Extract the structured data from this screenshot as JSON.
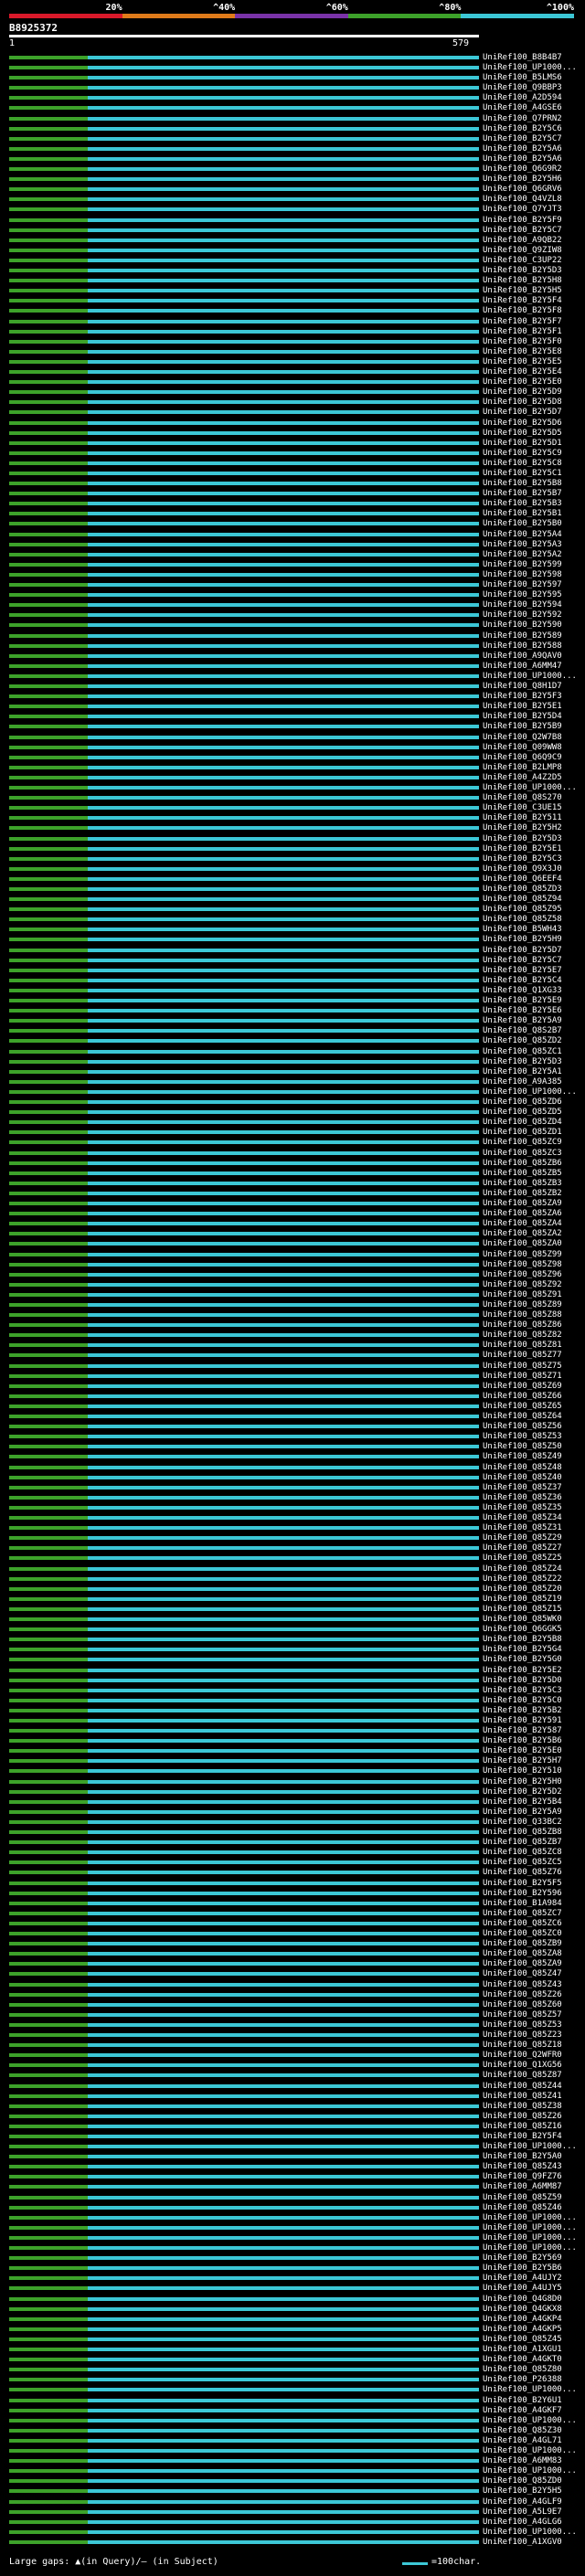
{
  "scale": {
    "labels": [
      "20%",
      "^40%",
      "^60%",
      "^80%",
      "^100%"
    ],
    "colors": [
      "#d9192a",
      "#e07b1a",
      "#7a33a8",
      "#3da22a",
      "#3cc7d6"
    ]
  },
  "query": {
    "id": "B8925372",
    "start": "1",
    "end": "579"
  },
  "colors": {
    "high": "#3cc7d6",
    "medium": "#3da22a",
    "background": "#000000",
    "text": "#ffffff"
  },
  "hits": [
    "UniRef100_B8B4B7",
    "UniRef100_UP1000...",
    "UniRef100_B5LMS6",
    "UniRef100_Q9BBP3",
    "UniRef100_A2D594",
    "UniRef100_A4GSE6",
    "UniRef100_Q7PRN2",
    "UniRef100_B2Y5C6",
    "UniRef100_B2Y5C7",
    "UniRef100_B2Y5A6",
    "UniRef100_B2Y5A6",
    "UniRef100_Q6G9R2",
    "UniRef100_B2Y5H6",
    "UniRef100_Q6GRV6",
    "UniRef100_Q4VZL8",
    "UniRef100_Q7YJT3",
    "UniRef100_B2Y5F9",
    "UniRef100_B2Y5C7",
    "UniRef100_A9QB22",
    "UniRef100_Q9ZIW8",
    "UniRef100_C3UP22",
    "UniRef100_B2Y5D3",
    "UniRef100_B2Y5H8",
    "UniRef100_B2Y5H5",
    "UniRef100_B2Y5F4",
    "UniRef100_B2Y5F8",
    "UniRef100_B2Y5F7",
    "UniRef100_B2Y5F1",
    "UniRef100_B2Y5F0",
    "UniRef100_B2Y5E8",
    "UniRef100_B2Y5E5",
    "UniRef100_B2Y5E4",
    "UniRef100_B2Y5E0",
    "UniRef100_B2Y5D9",
    "UniRef100_B2Y5D8",
    "UniRef100_B2Y5D7",
    "UniRef100_B2Y5D6",
    "UniRef100_B2Y5D5",
    "UniRef100_B2Y5D1",
    "UniRef100_B2Y5C9",
    "UniRef100_B2Y5C8",
    "UniRef100_B2Y5C1",
    "UniRef100_B2Y5B8",
    "UniRef100_B2Y5B7",
    "UniRef100_B2Y5B3",
    "UniRef100_B2Y5B1",
    "UniRef100_B2Y5B0",
    "UniRef100_B2Y5A4",
    "UniRef100_B2Y5A3",
    "UniRef100_B2Y5A2",
    "UniRef100_B2Y599",
    "UniRef100_B2Y598",
    "UniRef100_B2Y597",
    "UniRef100_B2Y595",
    "UniRef100_B2Y594",
    "UniRef100_B2Y592",
    "UniRef100_B2Y590",
    "UniRef100_B2Y589",
    "UniRef100_B2Y588",
    "UniRef100_A9QAV0",
    "UniRef100_A6MM47",
    "UniRef100_UP1000...",
    "UniRef100_Q8H1D7",
    "UniRef100_B2Y5F3",
    "UniRef100_B2Y5E1",
    "UniRef100_B2Y5D4",
    "UniRef100_B2Y5B9",
    "UniRef100_Q2W7B8",
    "UniRef100_Q09WW8",
    "UniRef100_Q6Q9C9",
    "UniRef100_B2LMP8",
    "UniRef100_A4Z2D5",
    "UniRef100_UP1000...",
    "UniRef100_Q8S270",
    "UniRef100_C3UE15",
    "UniRef100_B2Y511",
    "UniRef100_B2Y5H2",
    "UniRef100_B2Y5D3",
    "UniRef100_B2Y5E1",
    "UniRef100_B2Y5C3",
    "UniRef100_Q9X3J0",
    "UniRef100_Q6EEF4",
    "UniRef100_Q85ZD3",
    "UniRef100_Q85Z94",
    "UniRef100_Q85Z95",
    "UniRef100_Q85Z58",
    "UniRef100_B5WH43",
    "UniRef100_B2Y5H9",
    "UniRef100_B2Y5D7",
    "UniRef100_B2Y5C7",
    "UniRef100_B2Y5E7",
    "UniRef100_B2Y5C4",
    "UniRef100_Q1XG33",
    "UniRef100_B2Y5E9",
    "UniRef100_B2Y5E6",
    "UniRef100_B2Y5A9",
    "UniRef100_Q8S2B7",
    "UniRef100_Q85ZD2",
    "UniRef100_Q85ZC1",
    "UniRef100_B2Y5D3",
    "UniRef100_B2Y5A1",
    "UniRef100_A9A385",
    "UniRef100_UP1000...",
    "UniRef100_Q85ZD6",
    "UniRef100_Q85ZD5",
    "UniRef100_Q85ZD4",
    "UniRef100_Q85ZD1",
    "UniRef100_Q85ZC9",
    "UniRef100_Q85ZC3",
    "UniRef100_Q85ZB6",
    "UniRef100_Q85ZB5",
    "UniRef100_Q85ZB3",
    "UniRef100_Q85ZB2",
    "UniRef100_Q85ZA9",
    "UniRef100_Q85ZA6",
    "UniRef100_Q85ZA4",
    "UniRef100_Q85ZA2",
    "UniRef100_Q85ZA0",
    "UniRef100_Q85Z99",
    "UniRef100_Q85Z98",
    "UniRef100_Q85Z96",
    "UniRef100_Q85Z92",
    "UniRef100_Q85Z91",
    "UniRef100_Q85Z89",
    "UniRef100_Q85Z88",
    "UniRef100_Q85Z86",
    "UniRef100_Q85Z82",
    "UniRef100_Q85Z81",
    "UniRef100_Q85Z77",
    "UniRef100_Q85Z75",
    "UniRef100_Q85Z71",
    "UniRef100_Q85Z69",
    "UniRef100_Q85Z66",
    "UniRef100_Q85Z65",
    "UniRef100_Q85Z64",
    "UniRef100_Q85Z56",
    "UniRef100_Q85Z53",
    "UniRef100_Q85Z50",
    "UniRef100_Q85Z49",
    "UniRef100_Q85Z48",
    "UniRef100_Q85Z40",
    "UniRef100_Q85Z37",
    "UniRef100_Q85Z36",
    "UniRef100_Q85Z35",
    "UniRef100_Q85Z34",
    "UniRef100_Q85Z31",
    "UniRef100_Q85Z29",
    "UniRef100_Q85Z27",
    "UniRef100_Q85Z25",
    "UniRef100_Q85Z24",
    "UniRef100_Q85Z22",
    "UniRef100_Q85Z20",
    "UniRef100_Q85Z19",
    "UniRef100_Q85Z15",
    "UniRef100_Q85WK0",
    "UniRef100_Q6GGK5",
    "UniRef100_B2Y5B8",
    "UniRef100_B2Y5G4",
    "UniRef100_B2Y5G0",
    "UniRef100_B2Y5E2",
    "UniRef100_B2Y5D0",
    "UniRef100_B2Y5C3",
    "UniRef100_B2Y5C0",
    "UniRef100_B2Y5B2",
    "UniRef100_B2Y591",
    "UniRef100_B2Y587",
    "UniRef100_B2Y5B6",
    "UniRef100_B2Y5E0",
    "UniRef100_B2Y5H7",
    "UniRef100_B2Y510",
    "UniRef100_B2Y5H0",
    "UniRef100_B2Y5D2",
    "UniRef100_B2Y5B4",
    "UniRef100_B2Y5A9",
    "UniRef100_Q33BC2",
    "UniRef100_Q85ZB8",
    "UniRef100_Q85ZB7",
    "UniRef100_Q85ZC8",
    "UniRef100_Q85ZC5",
    "UniRef100_Q85Z76",
    "UniRef100_B2Y5F5",
    "UniRef100_B2Y596",
    "UniRef100_B1A984",
    "UniRef100_Q85ZC7",
    "UniRef100_Q85ZC6",
    "UniRef100_Q85ZC0",
    "UniRef100_Q85ZB9",
    "UniRef100_Q85ZA8",
    "UniRef100_Q85ZA9",
    "UniRef100_Q85Z47",
    "UniRef100_Q85Z43",
    "UniRef100_Q85Z26",
    "UniRef100_Q85Z60",
    "UniRef100_Q85Z57",
    "UniRef100_Q85Z53",
    "UniRef100_Q85Z23",
    "UniRef100_Q85Z18",
    "UniRef100_Q2WFR0",
    "UniRef100_Q1XG56",
    "UniRef100_Q85Z87",
    "UniRef100_Q85Z44",
    "UniRef100_Q85Z41",
    "UniRef100_Q85Z38",
    "UniRef100_Q85Z26",
    "UniRef100_Q85Z16",
    "UniRef100_B2Y5F4",
    "UniRef100_UP1000...",
    "UniRef100_B2Y5A0",
    "UniRef100_Q85Z43",
    "UniRef100_Q9FZ76",
    "UniRef100_A6MM87",
    "UniRef100_Q85Z59",
    "UniRef100_Q85Z46",
    "UniRef100_UP1000...",
    "UniRef100_UP1000...",
    "UniRef100_UP1000...",
    "UniRef100_UP1000...",
    "UniRef100_B2Y569",
    "UniRef100_B2Y5B6",
    "UniRef100_A4UJY2",
    "UniRef100_A4UJY5",
    "UniRef100_Q4G8D0",
    "UniRef100_Q4GKX8",
    "UniRef100_A4GKP4",
    "UniRef100_A4GKP5",
    "UniRef100_Q85Z45",
    "UniRef100_A1XGU1",
    "UniRef100_A4GKT0",
    "UniRef100_Q85Z80",
    "UniRef100_P26388",
    "UniRef100_UP1000...",
    "UniRef100_B2Y6U1",
    "UniRef100_A4GKF7",
    "UniRef100_UP1000...",
    "UniRef100_Q85Z30",
    "UniRef100_A4GL71",
    "UniRef100_UP1000...",
    "UniRef100_A6MM83",
    "UniRef100_UP1000...",
    "UniRef100_Q85ZD0",
    "UniRef100_B2Y5H5",
    "UniRef100_A4GLF9",
    "UniRef100_A5L9E7",
    "UniRef100_A4GLG6",
    "UniRef100_UP1000...",
    "UniRef100_A1XGV0"
  ],
  "legend": {
    "text": "Large gaps: ▲(in Query)/– (in Subject)",
    "scale_text": "=100char."
  }
}
